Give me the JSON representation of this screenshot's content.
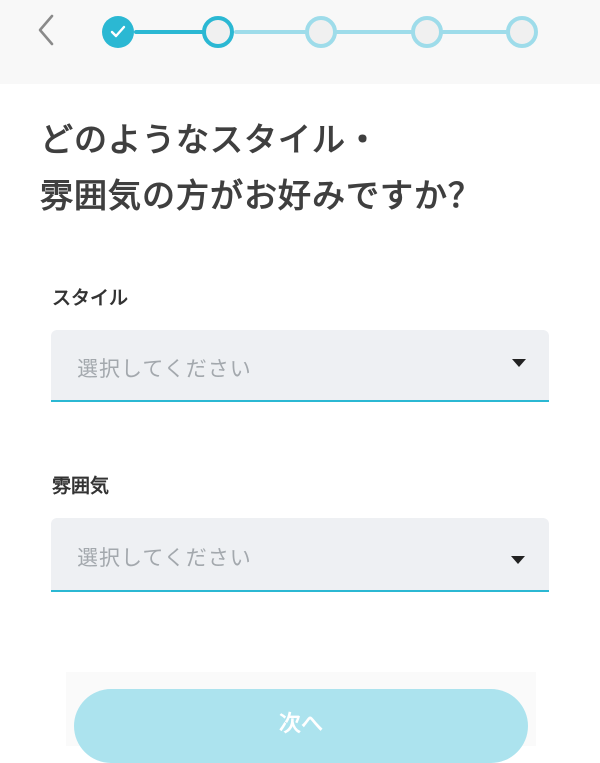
{
  "header": {
    "back_icon": "chevron-left-icon",
    "progress": {
      "total_steps": 5,
      "completed_steps": 1,
      "current_step": 2,
      "done_icon": "check-icon"
    }
  },
  "question": {
    "line1": "どのようなスタイル・",
    "line2": "雰囲気の方がお好みですか？"
  },
  "fields": {
    "style": {
      "label": "スタイル",
      "placeholder": "選択してください"
    },
    "atmosphere": {
      "label": "雰囲気",
      "placeholder": "選択してください"
    }
  },
  "footer": {
    "next_label": "次へ"
  },
  "colors": {
    "accent": "#2bb8d3",
    "accent_light": "#9edcea",
    "button_disabled": "#ace3ee",
    "title_text": "#3f3f3f",
    "placeholder_text": "#a3a8ad",
    "field_bg": "#eef0f3"
  }
}
